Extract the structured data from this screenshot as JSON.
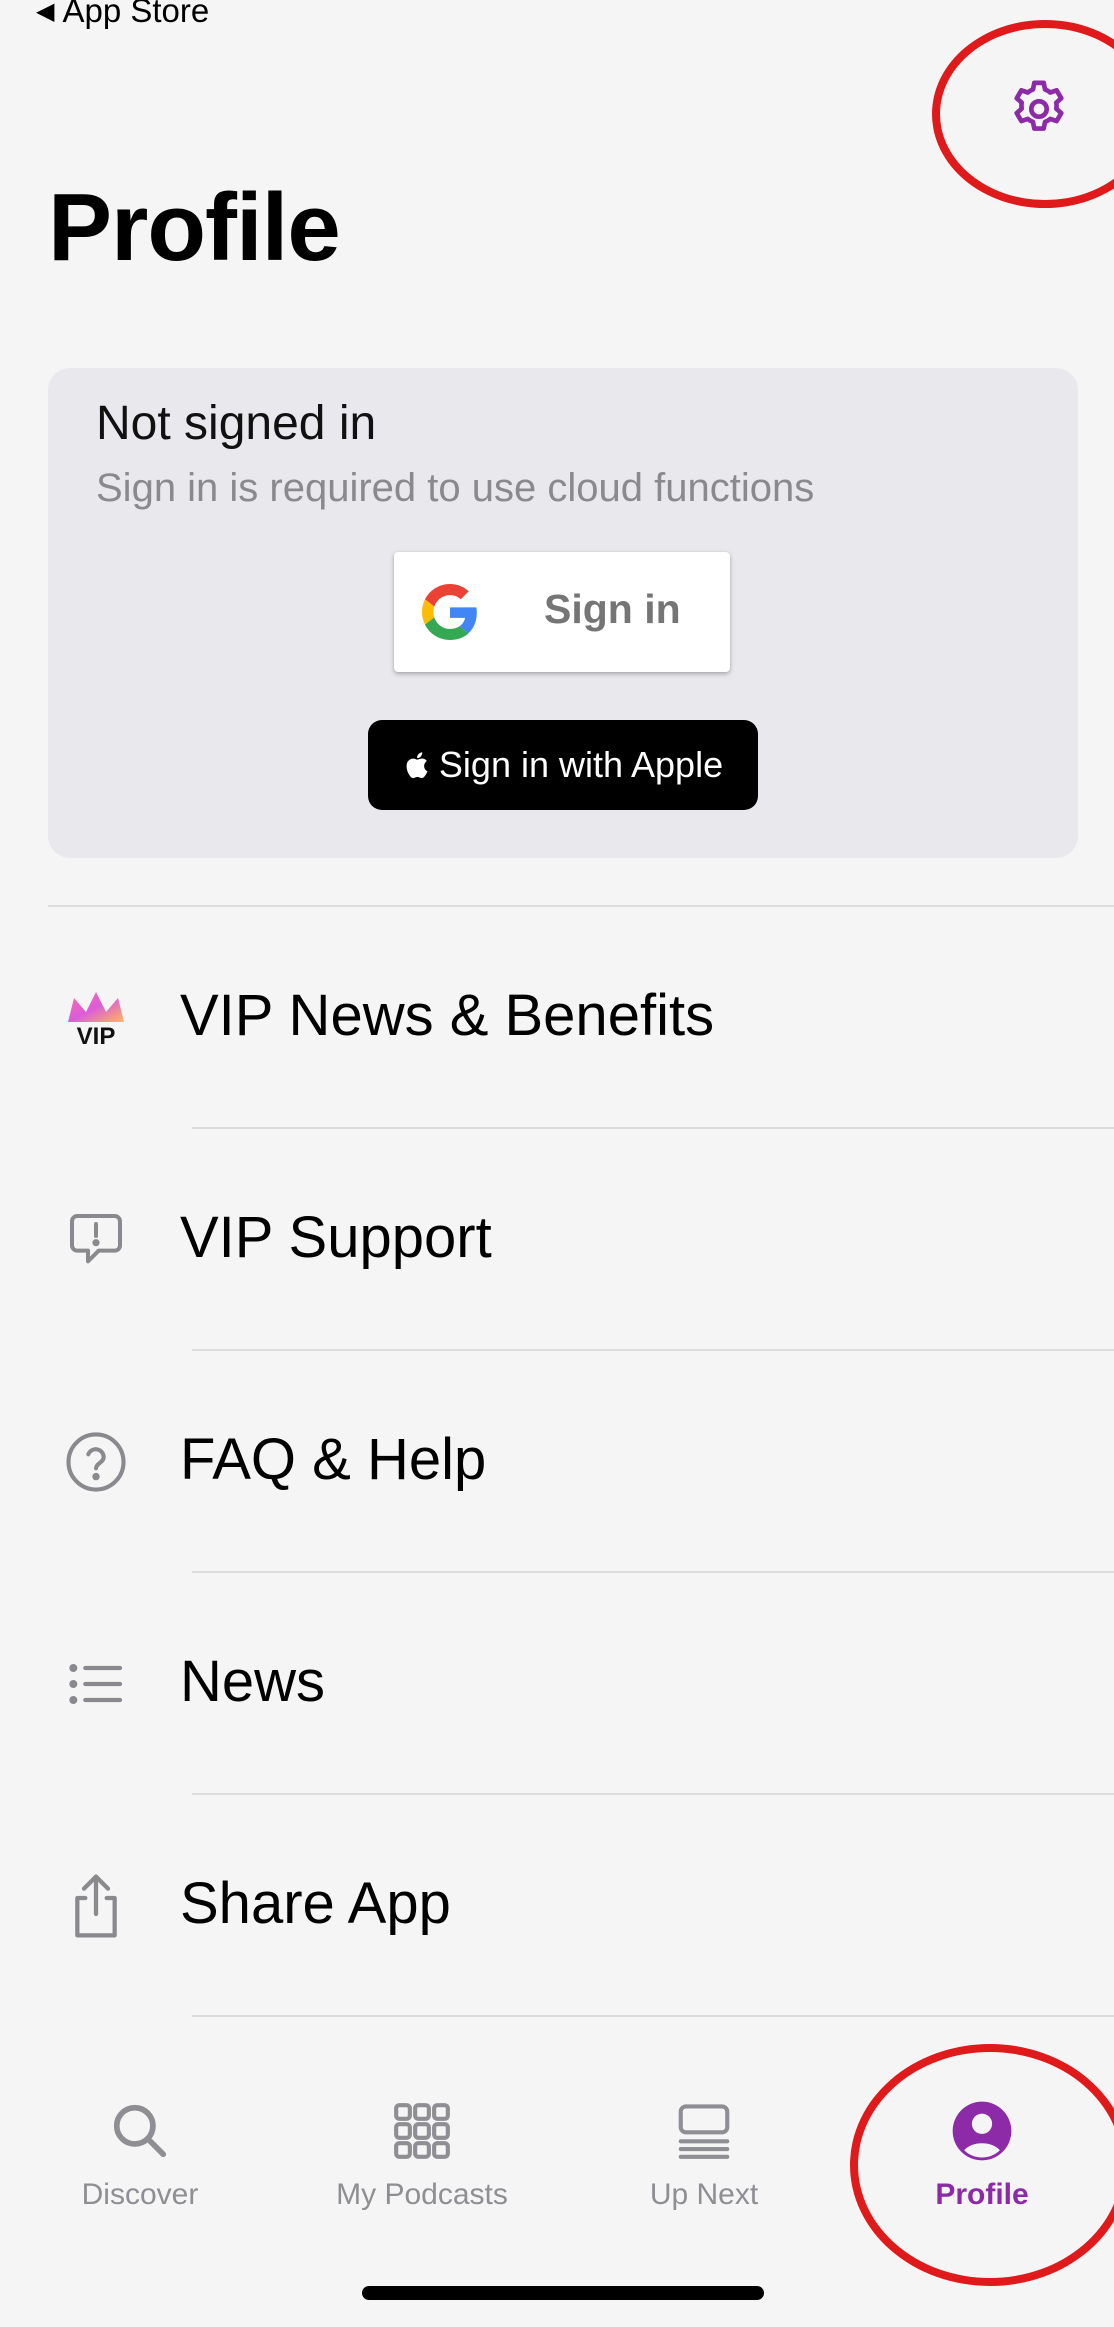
{
  "status": {
    "back_label": "App Store"
  },
  "header": {
    "title": "Profile"
  },
  "signin": {
    "title": "Not signed in",
    "subtitle": "Sign in is required to use cloud functions",
    "google_label": "Sign in",
    "apple_label": "Sign in with Apple"
  },
  "menu": {
    "items": [
      {
        "label": "VIP News & Benefits",
        "icon": "vip-crown-icon"
      },
      {
        "label": "VIP Support",
        "icon": "support-bubble-icon"
      },
      {
        "label": "FAQ & Help",
        "icon": "question-circle-icon"
      },
      {
        "label": "News",
        "icon": "list-icon"
      },
      {
        "label": "Share App",
        "icon": "share-icon"
      }
    ]
  },
  "tabs": {
    "items": [
      {
        "label": "Discover",
        "icon": "search-icon"
      },
      {
        "label": "My Podcasts",
        "icon": "grid-icon"
      },
      {
        "label": "Up Next",
        "icon": "queue-icon"
      },
      {
        "label": "Profile",
        "icon": "person-icon",
        "active": true
      }
    ]
  },
  "vip_badge": {
    "text": "VIP"
  },
  "colors": {
    "accent": "#8c2aa8",
    "annotation": "#e0191b",
    "background": "#f5f5f5",
    "card": "#e9e8ec"
  }
}
